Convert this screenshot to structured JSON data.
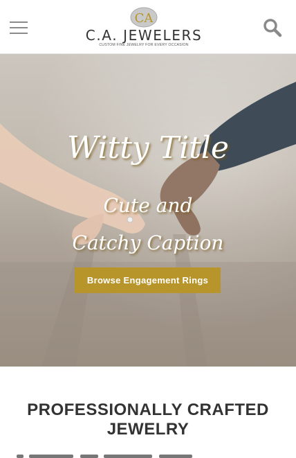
{
  "header": {
    "menu_icon": "hamburger-menu-icon",
    "logo": {
      "monogram": "CA",
      "name": "C.A. JEWELERS",
      "tagline": "CUSTOM FINE JEWELRY FOR EVERY OCCASION"
    },
    "search_icon": "search-icon"
  },
  "hero": {
    "title": "Witty Title",
    "caption_line1": "Cute and",
    "caption_line2": "Catchy Caption",
    "button_label": "Browse Engagement Rings"
  },
  "section": {
    "title_line1": "PROFESSIONALLY CRAFTED",
    "title_line2": "JEWELRY"
  },
  "colors": {
    "accent_gold": "#b7952a",
    "text_dark": "#333333",
    "icon_gray": "#8a8a8a"
  }
}
